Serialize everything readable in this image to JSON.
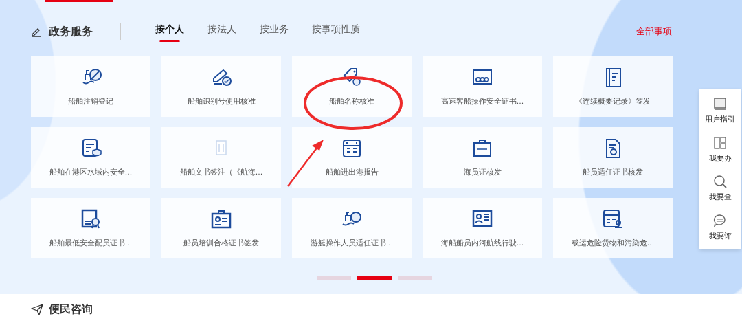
{
  "section": {
    "title": "政务服务",
    "more_link": "全部事项"
  },
  "tabs": [
    {
      "label": "按个人",
      "selected": true
    },
    {
      "label": "按法人",
      "selected": false
    },
    {
      "label": "按业务",
      "selected": false
    },
    {
      "label": "按事项性质",
      "selected": false
    }
  ],
  "services": [
    {
      "label": "船舶注销登记"
    },
    {
      "label": "船舶识别号使用核准"
    },
    {
      "label": "船舶名称核准"
    },
    {
      "label": "高速客船操作安全证书..."
    },
    {
      "label": "《连续概要记录》签发"
    },
    {
      "label": "船舶在港区水域内安全..."
    },
    {
      "label": "船舶文书签注（《航海..."
    },
    {
      "label": "船舶进出港报告"
    },
    {
      "label": "海员证核发"
    },
    {
      "label": "船员适任证书核发"
    },
    {
      "label": "船舶最低安全配员证书..."
    },
    {
      "label": "船员培训合格证书签发"
    },
    {
      "label": "游艇操作人员适任证书..."
    },
    {
      "label": "海船船员内河航线行驶..."
    },
    {
      "label": "载运危险货物和污染危..."
    }
  ],
  "pager": [
    {
      "selected": false
    },
    {
      "selected": true
    },
    {
      "selected": false
    }
  ],
  "side_menu": [
    {
      "label": "用户指引"
    },
    {
      "label": "我要办"
    },
    {
      "label": "我要查"
    },
    {
      "label": "我要评"
    }
  ],
  "next_section": {
    "title": "便民咨询"
  }
}
